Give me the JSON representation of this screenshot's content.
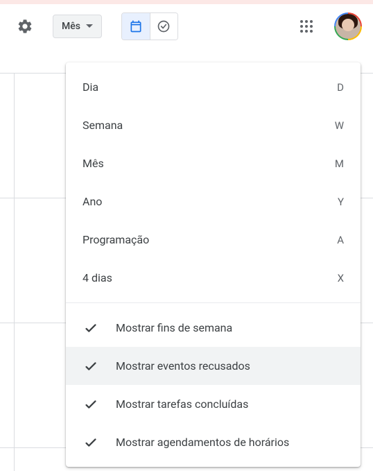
{
  "toolbar": {
    "view_label": "Mês"
  },
  "menu": {
    "views": [
      {
        "label": "Dia",
        "shortcut": "D"
      },
      {
        "label": "Semana",
        "shortcut": "W"
      },
      {
        "label": "Mês",
        "shortcut": "M"
      },
      {
        "label": "Ano",
        "shortcut": "Y"
      },
      {
        "label": "Programação",
        "shortcut": "A"
      },
      {
        "label": "4 dias",
        "shortcut": "X"
      }
    ],
    "toggles": [
      {
        "label": "Mostrar fins de semana"
      },
      {
        "label": "Mostrar eventos recusados"
      },
      {
        "label": "Mostrar tarefas concluídas"
      },
      {
        "label": "Mostrar agendamentos de horários"
      }
    ]
  }
}
